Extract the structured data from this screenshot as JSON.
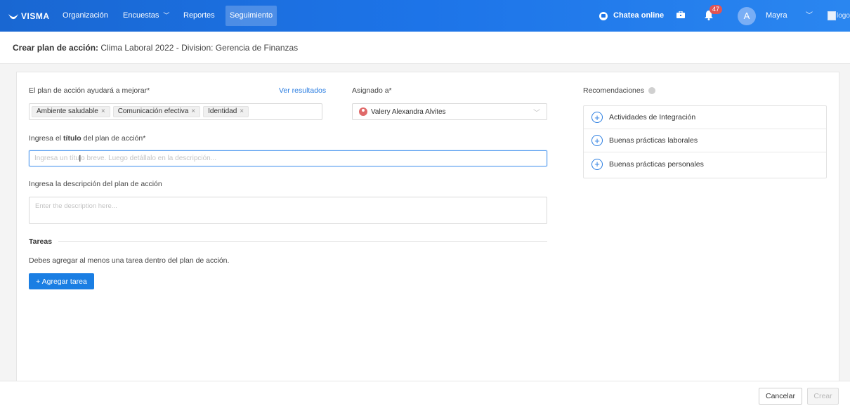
{
  "topbar": {
    "brand": "VISMA",
    "nav": [
      {
        "label": "Organización"
      },
      {
        "label": "Encuestas"
      },
      {
        "label": "Reportes"
      },
      {
        "label": "Seguimiento",
        "active": true
      }
    ],
    "chat_label": "Chatea online",
    "notification_count": "47",
    "avatar_initial": "A",
    "user_name": "Mayra",
    "logo_alt": "logo"
  },
  "header": {
    "title_bold": "Crear plan de acción:",
    "title_rest": " Clima Laboral 2022 - Division: Gerencia de Finanzas"
  },
  "form": {
    "improve_label": "El plan de acción ayudará a mejorar*",
    "see_results": "Ver resultados",
    "tags": [
      "Ambiente saludable",
      "Comunicación efectiva",
      "Identidad"
    ],
    "assigned_label": "Asignado a*",
    "assigned_value": "Valery Alexandra Alvites",
    "title_label_pre": "Ingresa el ",
    "title_label_bold": "título",
    "title_label_post": " del plan de acción*",
    "title_placeholder": "Ingresa un título breve. Luego detállalo en la descripción...",
    "desc_label": "Ingresa la descripción del plan de acción",
    "desc_placeholder": "Enter the description here..."
  },
  "tasks": {
    "title": "Tareas",
    "message": "Debes agregar al menos una tarea dentro del plan de acción.",
    "add_button": "+ Agregar tarea"
  },
  "recommendations": {
    "title": "Recomendaciones",
    "items": [
      "Actividades de Integración",
      "Buenas prácticas laborales",
      "Buenas prácticas personales"
    ]
  },
  "footer": {
    "cancel": "Cancelar",
    "create": "Crear"
  }
}
